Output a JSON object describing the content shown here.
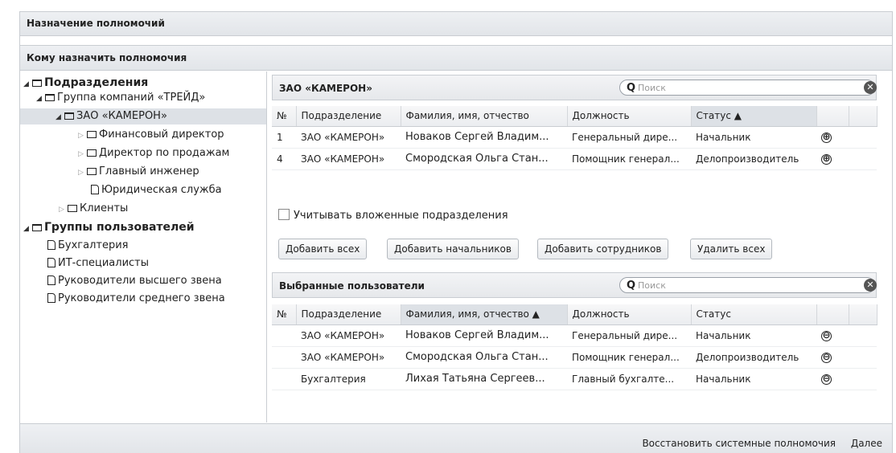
{
  "window": {
    "title": "Назначение полномочий",
    "subtitle": "Кому назначить полномочия"
  },
  "tree": {
    "departments_label": "Подразделения",
    "company_group": "Группа компаний «ТРЕЙД»",
    "company": "ЗАО «КАМЕРОН»",
    "children": [
      "Финансовый директор",
      "Директор по продажам",
      "Главный инженер",
      "Юридическая служба"
    ],
    "clients": "Клиенты",
    "user_groups_label": "Группы пользователей",
    "user_groups": [
      "Бухгалтерия",
      "ИТ-специалисты",
      "Руководители высшего звена",
      "Руководители среднего звена"
    ]
  },
  "top_panel": {
    "title": "ЗАО «КАМЕРОН»",
    "search_placeholder": "Поиск",
    "columns": [
      "№",
      "Подразделение",
      "Фамилия, имя, отчество",
      "Должность",
      "Статус ▲"
    ],
    "rows": [
      {
        "num": "1",
        "dept": "ЗАО «КАМЕРОН»",
        "fio": "Новаков Сергей Владим...",
        "pos": "Генеральный дире...",
        "status": "Начальник",
        "action": "⊕"
      },
      {
        "num": "4",
        "dept": "ЗАО «КАМЕРОН»",
        "fio": "Смородская Ольга Стан...",
        "pos": "Помощник генерал...",
        "status": "Делопроизводитель",
        "action": "⊕"
      }
    ]
  },
  "include_nested": {
    "label": "Учитывать вложенные подразделения",
    "checked": false
  },
  "buttons": {
    "add_all": "Добавить всех",
    "add_heads": "Добавить начальников",
    "add_staff": "Добавить сотрудников",
    "remove_all": "Удалить всех"
  },
  "bottom_panel": {
    "title": "Выбранные пользователи",
    "search_placeholder": "Поиск",
    "columns": [
      "№",
      "Подразделение",
      "Фамилия, имя, отчество ▲",
      "Должность",
      "Статус"
    ],
    "rows": [
      {
        "num": "",
        "dept": "ЗАО «КАМЕРОН»",
        "fio": "Новаков Сергей Владим...",
        "pos": "Генеральный дире...",
        "status": "Начальник",
        "action": "⊖"
      },
      {
        "num": "",
        "dept": "ЗАО «КАМЕРОН»",
        "fio": "Смородская Ольга Стан...",
        "pos": "Помощник генерал...",
        "status": "Делопроизводитель",
        "action": "⊖"
      },
      {
        "num": "",
        "dept": "Бухгалтерия",
        "fio": "Лихая Татьяна Сергеев...",
        "pos": "Главный бухгалте...",
        "status": "Начальник",
        "action": "⊖"
      }
    ]
  },
  "footer": {
    "restore": "Восстановить системные полномочия",
    "next": "Далее"
  }
}
